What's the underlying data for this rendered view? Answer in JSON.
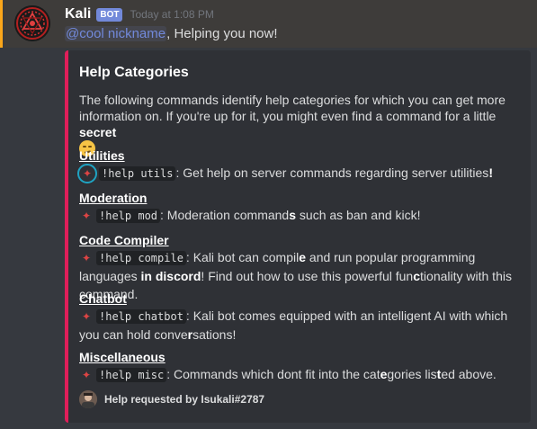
{
  "message": {
    "username": "Kali",
    "bot_tag": "BOT",
    "timestamp": "Today at 1:08 PM",
    "mention": "@cool nickname",
    "content_rest": ", Helping you now!"
  },
  "embed": {
    "accent_color": "#e01e5a",
    "title": "Help Categories",
    "description_parts": {
      "text": "The following commands identify help categories for which you can get more information on. If you're up for it, you might even find a command for a little ",
      "bold": "secret"
    },
    "fields": [
      {
        "name": "Utilities",
        "command": "!help utils",
        "text_a": ": Get help on server commands regarding server utilities",
        "bold_a": "!",
        "text_b": ""
      },
      {
        "name": "Moderation",
        "command": "!help mod",
        "text_a": ": Moderation command",
        "bold_a": "s",
        "text_b": " such as ban and kick!"
      },
      {
        "name": "Code Compiler",
        "command": "!help compile",
        "text_a": ": Kali bot can compil",
        "bold_a": "e",
        "text_b": " and run popular programming languages ",
        "bold_b": "in discord",
        "text_c": "! Find out how to use this powerful fun",
        "bold_c": "c",
        "text_d": "tionality with this command."
      },
      {
        "name": "Chatbot",
        "command": "!help chatbot",
        "text_a": ": Kali bot comes equipped with an intelligent AI with which you can hold conve",
        "bold_a": "r",
        "text_b": "sations!"
      },
      {
        "name": "Miscellaneous",
        "command": "!help misc",
        "text_a": ": Commands which dont fit into the cat",
        "bold_a": "e",
        "text_b": "gories lis",
        "bold_b": "t",
        "text_c": "ed above."
      }
    ],
    "footer": {
      "text": "Help requested by Isukali#2787"
    }
  },
  "icons": {
    "bullet": "✦",
    "emoji": "smirk-emoji"
  }
}
